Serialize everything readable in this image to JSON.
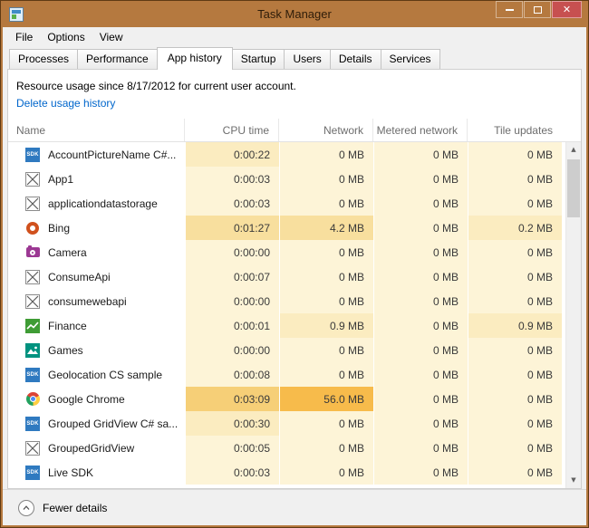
{
  "window": {
    "title": "Task Manager"
  },
  "menu": {
    "items": [
      "File",
      "Options",
      "View"
    ]
  },
  "tabs": {
    "items": [
      "Processes",
      "Performance",
      "App history",
      "Startup",
      "Users",
      "Details",
      "Services"
    ],
    "active": "App history"
  },
  "info": {
    "usage_text": "Resource usage since 8/17/2012 for current user account.",
    "delete_link": "Delete usage history"
  },
  "table": {
    "columns": [
      {
        "label": "Name",
        "align": "left"
      },
      {
        "label": "CPU time",
        "align": "right"
      },
      {
        "label": "Network",
        "align": "right"
      },
      {
        "label": "Metered network",
        "align": "right"
      },
      {
        "label": "Tile updates",
        "align": "right"
      }
    ],
    "rows": [
      {
        "name": "AccountPictureName C#...",
        "icon": "sdk",
        "values": [
          {
            "text": "0:00:22",
            "heat": 1
          },
          {
            "text": "0 MB",
            "heat": 0
          },
          {
            "text": "0 MB",
            "heat": 0
          },
          {
            "text": "0 MB",
            "heat": 0
          }
        ]
      },
      {
        "name": "App1",
        "icon": "placeholder",
        "values": [
          {
            "text": "0:00:03",
            "heat": 0
          },
          {
            "text": "0 MB",
            "heat": 0
          },
          {
            "text": "0 MB",
            "heat": 0
          },
          {
            "text": "0 MB",
            "heat": 0
          }
        ]
      },
      {
        "name": "applicationdatastorage",
        "icon": "placeholder",
        "values": [
          {
            "text": "0:00:03",
            "heat": 0
          },
          {
            "text": "0 MB",
            "heat": 0
          },
          {
            "text": "0 MB",
            "heat": 0
          },
          {
            "text": "0 MB",
            "heat": 0
          }
        ]
      },
      {
        "name": "Bing",
        "icon": "bing",
        "values": [
          {
            "text": "0:01:27",
            "heat": 2
          },
          {
            "text": "4.2 MB",
            "heat": 2
          },
          {
            "text": "0 MB",
            "heat": 0
          },
          {
            "text": "0.2 MB",
            "heat": 1
          }
        ]
      },
      {
        "name": "Camera",
        "icon": "camera",
        "values": [
          {
            "text": "0:00:00",
            "heat": 0
          },
          {
            "text": "0 MB",
            "heat": 0
          },
          {
            "text": "0 MB",
            "heat": 0
          },
          {
            "text": "0 MB",
            "heat": 0
          }
        ]
      },
      {
        "name": "ConsumeApi",
        "icon": "placeholder",
        "values": [
          {
            "text": "0:00:07",
            "heat": 0
          },
          {
            "text": "0 MB",
            "heat": 0
          },
          {
            "text": "0 MB",
            "heat": 0
          },
          {
            "text": "0 MB",
            "heat": 0
          }
        ]
      },
      {
        "name": "consumewebapi",
        "icon": "placeholder",
        "values": [
          {
            "text": "0:00:00",
            "heat": 0
          },
          {
            "text": "0 MB",
            "heat": 0
          },
          {
            "text": "0 MB",
            "heat": 0
          },
          {
            "text": "0 MB",
            "heat": 0
          }
        ]
      },
      {
        "name": "Finance",
        "icon": "finance",
        "values": [
          {
            "text": "0:00:01",
            "heat": 0
          },
          {
            "text": "0.9 MB",
            "heat": 1
          },
          {
            "text": "0 MB",
            "heat": 0
          },
          {
            "text": "0.9 MB",
            "heat": 1
          }
        ]
      },
      {
        "name": "Games",
        "icon": "games",
        "values": [
          {
            "text": "0:00:00",
            "heat": 0
          },
          {
            "text": "0 MB",
            "heat": 0
          },
          {
            "text": "0 MB",
            "heat": 0
          },
          {
            "text": "0 MB",
            "heat": 0
          }
        ]
      },
      {
        "name": "Geolocation CS sample",
        "icon": "sdk",
        "values": [
          {
            "text": "0:00:08",
            "heat": 0
          },
          {
            "text": "0 MB",
            "heat": 0
          },
          {
            "text": "0 MB",
            "heat": 0
          },
          {
            "text": "0 MB",
            "heat": 0
          }
        ]
      },
      {
        "name": "Google Chrome",
        "icon": "chrome",
        "values": [
          {
            "text": "0:03:09",
            "heat": 3
          },
          {
            "text": "56.0 MB",
            "heat": 4
          },
          {
            "text": "0 MB",
            "heat": 0
          },
          {
            "text": "0 MB",
            "heat": 0
          }
        ]
      },
      {
        "name": "Grouped GridView C# sa...",
        "icon": "sdk",
        "values": [
          {
            "text": "0:00:30",
            "heat": 1
          },
          {
            "text": "0 MB",
            "heat": 0
          },
          {
            "text": "0 MB",
            "heat": 0
          },
          {
            "text": "0 MB",
            "heat": 0
          }
        ]
      },
      {
        "name": "GroupedGridView",
        "icon": "placeholder",
        "values": [
          {
            "text": "0:00:05",
            "heat": 0
          },
          {
            "text": "0 MB",
            "heat": 0
          },
          {
            "text": "0 MB",
            "heat": 0
          },
          {
            "text": "0 MB",
            "heat": 0
          }
        ]
      },
      {
        "name": "Live SDK",
        "icon": "sdk",
        "values": [
          {
            "text": "0:00:03",
            "heat": 0
          },
          {
            "text": "0 MB",
            "heat": 0
          },
          {
            "text": "0 MB",
            "heat": 0
          },
          {
            "text": "0 MB",
            "heat": 0
          }
        ]
      }
    ]
  },
  "scrollbar": {
    "up_glyph": "▲",
    "down_glyph": "▼"
  },
  "footer": {
    "fewer_details": "Fewer details"
  },
  "colors": {
    "titlebar": "#b5793f",
    "close_button": "#c75050",
    "link": "#0066cc",
    "heat": [
      "#fdf4d7",
      "#fbecc0",
      "#f8df9e",
      "#f6cf77",
      "#f7bb4b"
    ]
  }
}
